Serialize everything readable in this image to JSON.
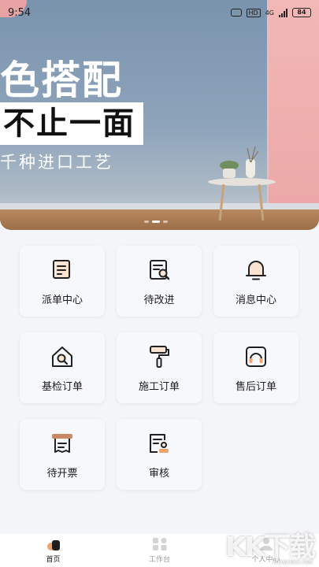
{
  "status_bar": {
    "time": "9:54",
    "hd_label": "HD",
    "network_label": "4G",
    "battery": "84"
  },
  "banner": {
    "headline": "色搭配",
    "subline": "不止一面",
    "tagline": "千种进口工艺"
  },
  "menu": [
    {
      "label": "派单中心",
      "icon": "dispatch-list-icon"
    },
    {
      "label": "待改进",
      "icon": "pending-improvement-icon"
    },
    {
      "label": "消息中心",
      "icon": "bell-icon"
    },
    {
      "label": "基检订单",
      "icon": "house-inspection-icon"
    },
    {
      "label": "施工订单",
      "icon": "paint-roller-icon"
    },
    {
      "label": "售后订单",
      "icon": "after-sales-headset-icon"
    },
    {
      "label": "待开票",
      "icon": "invoice-printer-icon"
    },
    {
      "label": "审核",
      "icon": "review-stamp-icon"
    }
  ],
  "bottom_nav": [
    {
      "label": "首页",
      "icon": "home-icon",
      "active": true
    },
    {
      "label": "工作台",
      "icon": "workbench-icon",
      "active": false
    },
    {
      "label": "个人中心",
      "icon": "profile-icon",
      "active": false
    }
  ],
  "watermark": {
    "logo": "KK下载",
    "url": "www.kkx.net"
  },
  "colors": {
    "accent": "#f0a36b",
    "icon_stroke": "#222222",
    "banner_blue": "#8ea4bb",
    "banner_pink": "#eba6a6"
  }
}
